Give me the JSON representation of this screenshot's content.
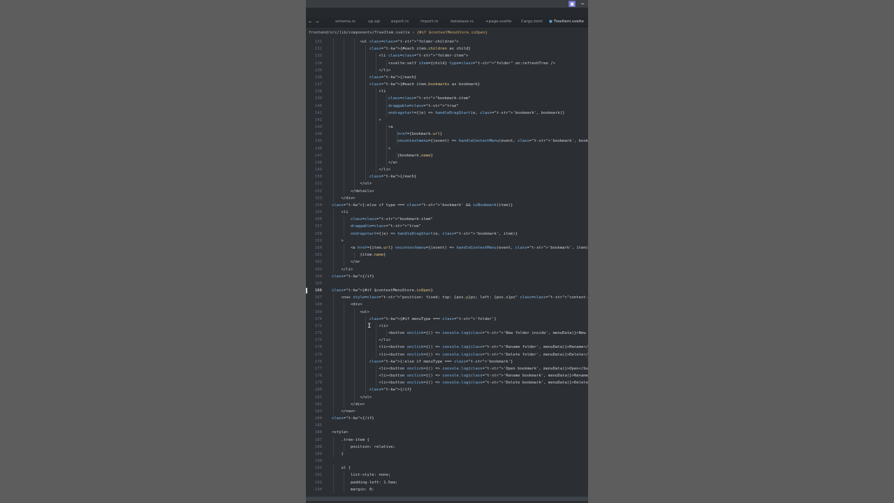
{
  "tabs": [
    {
      "label": "schema.rs",
      "active": false
    },
    {
      "label": "up.sql",
      "active": false
    },
    {
      "label": "export.rs",
      "active": false
    },
    {
      "label": "import.rs",
      "active": false
    },
    {
      "label": "database.rs",
      "active": false
    },
    {
      "label": "+page.svelte",
      "active": false
    },
    {
      "label": "Cargo.toml",
      "active": false
    },
    {
      "label": "TreeItem.svelte",
      "active": true
    }
  ],
  "breadcrumb": {
    "path": "frontend/src/lib/components/TreeItem.svelte",
    "separator": " › ",
    "symbol": "{#if $contextMenuStore.isOpen}"
  },
  "current_line": "166",
  "lines": [
    {
      "n": "131",
      "t": "            <ul class=\"folder-children\">"
    },
    {
      "n": "132",
      "t": "                {#each item.children as child}"
    },
    {
      "n": "133",
      "t": "                    <li class=\"folder-item\">"
    },
    {
      "n": "134",
      "t": "                        <svelte:self item={child} type=\"folder\" on:refreshTree />"
    },
    {
      "n": "135",
      "t": "                    </li>"
    },
    {
      "n": "136",
      "t": "                {/each}"
    },
    {
      "n": "137",
      "t": "                {#each item.bookmarks as bookmark}"
    },
    {
      "n": "138",
      "t": "                    <li"
    },
    {
      "n": "139",
      "t": "                        class=\"bookmark-item\""
    },
    {
      "n": "140",
      "t": "                        draggable=\"true\""
    },
    {
      "n": "141",
      "t": "                        ondragstart={(e) => handleDragStart(e, 'bookmark', bookmark)}"
    },
    {
      "n": "142",
      "t": "                    >"
    },
    {
      "n": "143",
      "t": "                        <a"
    },
    {
      "n": "144",
      "t": "                            href={bookmark.url}"
    },
    {
      "n": "145",
      "t": "                            oncontextmenu={(event) => handleContextMenu(event, 'bookmark', bookm"
    },
    {
      "n": "146",
      "t": "                        >"
    },
    {
      "n": "147",
      "t": "                            {bookmark.name}"
    },
    {
      "n": "148",
      "t": "                        </a>"
    },
    {
      "n": "149",
      "t": "                    </li>"
    },
    {
      "n": "150",
      "t": "                {/each}"
    },
    {
      "n": "151",
      "t": "            </ul>"
    },
    {
      "n": "152",
      "t": "        </details>"
    },
    {
      "n": "153",
      "t": "    </div>"
    },
    {
      "n": "154",
      "t": "{:else if type === 'bookmark' && isBookmark(item)}"
    },
    {
      "n": "155",
      "t": "    <li"
    },
    {
      "n": "156",
      "t": "        class=\"bookmark-item\""
    },
    {
      "n": "157",
      "t": "        draggable=\"true\""
    },
    {
      "n": "158",
      "t": "        ondragstart={(e) => handleDragStart(e, 'bookmark', item)}"
    },
    {
      "n": "159",
      "t": "    >"
    },
    {
      "n": "160",
      "t": "        <a href={item.url} oncontextmenu={(event) => handleContextMenu(event, 'bookmark', item)}>"
    },
    {
      "n": "161",
      "t": "            {item.name}"
    },
    {
      "n": "162",
      "t": "        </a>"
    },
    {
      "n": "163",
      "t": "    </li>"
    },
    {
      "n": "164",
      "t": "{/if}"
    },
    {
      "n": "165",
      "t": ""
    },
    {
      "n": "166",
      "t": "{#if $contextMenuStore.isOpen}"
    },
    {
      "n": "167",
      "t": "    <nav style=\"position: fixed; top: {pos.y}px; left: {pos.x}px\" class=\"context-menu\">"
    },
    {
      "n": "168",
      "t": "        <div>"
    },
    {
      "n": "169",
      "t": "            <ul>"
    },
    {
      "n": "170",
      "t": "                {#if menuType === 'folder'}"
    },
    {
      "n": "171",
      "t": "                    <li>"
    },
    {
      "n": "172",
      "t": "                        <button onclick={() => console.log('New folder inside', menuData)}>New F"
    },
    {
      "n": "173",
      "t": "                    </li>"
    },
    {
      "n": "174",
      "t": "                    <li><button onclick={() => console.log('Rename folder', menuData)}>Rename</b"
    },
    {
      "n": "175",
      "t": "                    <li><button onclick={() => console.log('Delete folder', menuData)}>Delete</b"
    },
    {
      "n": "176",
      "t": "                {:else if menuType === 'bookmark'}"
    },
    {
      "n": "177",
      "t": "                    <li><button onclick={() => console.log('Open bookmark', menuData)}>Open</but"
    },
    {
      "n": "178",
      "t": "                    <li><button onclick={() => console.log('Rename bookmark', menuData)}>Rename<"
    },
    {
      "n": "179",
      "t": "                    <li><button onclick={() => console.log('Delete bookmark', menuData)}>Delete<"
    },
    {
      "n": "180",
      "t": "                {/if}"
    },
    {
      "n": "181",
      "t": "            </ul>"
    },
    {
      "n": "182",
      "t": "        </div>"
    },
    {
      "n": "183",
      "t": "    </nav>"
    },
    {
      "n": "184",
      "t": "{/if}"
    },
    {
      "n": "185",
      "t": ""
    },
    {
      "n": "186",
      "t": "<style>"
    },
    {
      "n": "187",
      "t": "    .tree-item {"
    },
    {
      "n": "188",
      "t": "        position: relative;"
    },
    {
      "n": "189",
      "t": "    }"
    },
    {
      "n": "190",
      "t": ""
    },
    {
      "n": "191",
      "t": "    ul {"
    },
    {
      "n": "192",
      "t": "        list-style: none;"
    },
    {
      "n": "193",
      "t": "        padding-left: 1.5em;"
    },
    {
      "n": "194",
      "t": "        margin: 0;"
    }
  ]
}
